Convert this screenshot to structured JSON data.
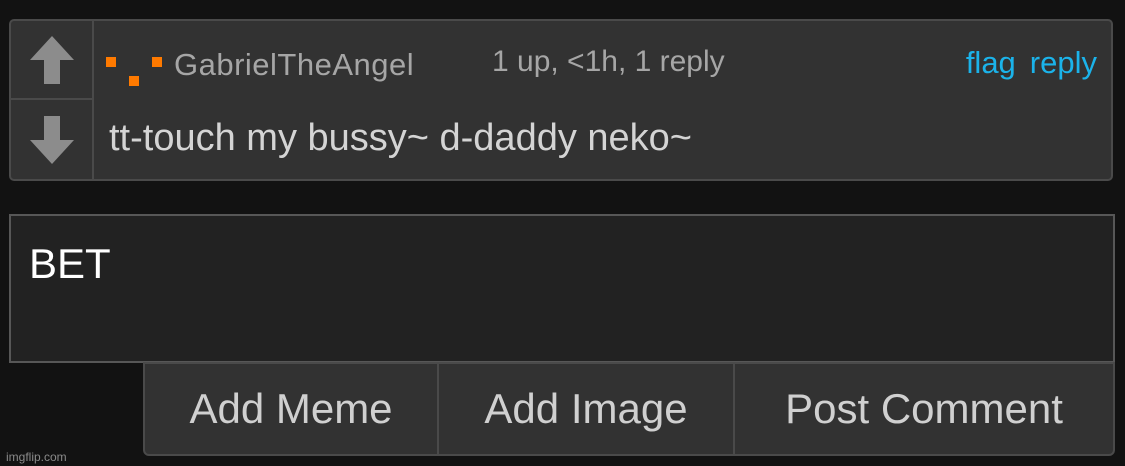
{
  "comment": {
    "username": "GabrielTheAngel",
    "meta": "1 up, <1h, 1 reply",
    "actions": {
      "flag": "flag",
      "reply": "reply"
    },
    "text": "tt-touch my bussy~ d-daddy neko~",
    "icons": {
      "upvote": "arrow-up-icon",
      "downvote": "arrow-down-icon",
      "avatar": "pixel-avatar-icon"
    }
  },
  "reply_box": {
    "value": "BET"
  },
  "buttons": {
    "add_meme": "Add Meme",
    "add_image": "Add Image",
    "post_comment": "Post Comment"
  },
  "watermark": "imgflip.com",
  "colors": {
    "background": "#121212",
    "card": "#323232",
    "link": "#1bb3ea",
    "avatar_accent": "#ff7a00",
    "arrow": "#8c8c8c"
  }
}
